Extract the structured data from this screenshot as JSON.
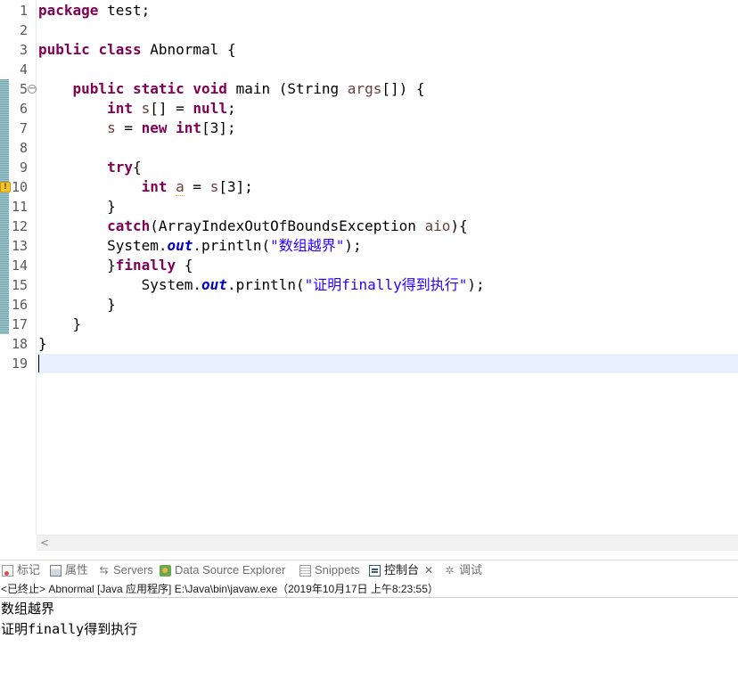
{
  "editor": {
    "current_line": 19,
    "lines": [
      {
        "num": "1",
        "tokens": [
          {
            "t": "package",
            "c": "kw"
          },
          {
            "t": " test;",
            "c": ""
          }
        ]
      },
      {
        "num": "2",
        "tokens": []
      },
      {
        "num": "3",
        "tokens": [
          {
            "t": "public",
            "c": "kw"
          },
          {
            "t": " ",
            "c": ""
          },
          {
            "t": "class",
            "c": "kw"
          },
          {
            "t": " Abnormal {",
            "c": ""
          }
        ]
      },
      {
        "num": "4",
        "tokens": []
      },
      {
        "num": "5",
        "tokens": [
          {
            "t": "    ",
            "c": ""
          },
          {
            "t": "public",
            "c": "kw"
          },
          {
            "t": " ",
            "c": ""
          },
          {
            "t": "static",
            "c": "kw"
          },
          {
            "t": " ",
            "c": ""
          },
          {
            "t": "void",
            "c": "kw"
          },
          {
            "t": " main (String ",
            "c": ""
          },
          {
            "t": "args",
            "c": "var"
          },
          {
            "t": "[]) {",
            "c": ""
          }
        ]
      },
      {
        "num": "6",
        "tokens": [
          {
            "t": "        ",
            "c": ""
          },
          {
            "t": "int",
            "c": "kw"
          },
          {
            "t": " ",
            "c": ""
          },
          {
            "t": "s",
            "c": "var"
          },
          {
            "t": "[] = ",
            "c": ""
          },
          {
            "t": "null",
            "c": "kw"
          },
          {
            "t": ";",
            "c": ""
          }
        ]
      },
      {
        "num": "7",
        "tokens": [
          {
            "t": "        ",
            "c": ""
          },
          {
            "t": "s",
            "c": "var"
          },
          {
            "t": " = ",
            "c": ""
          },
          {
            "t": "new",
            "c": "kw"
          },
          {
            "t": " ",
            "c": ""
          },
          {
            "t": "int",
            "c": "kw"
          },
          {
            "t": "[3];",
            "c": ""
          }
        ]
      },
      {
        "num": "8",
        "tokens": []
      },
      {
        "num": "9",
        "tokens": [
          {
            "t": "        ",
            "c": ""
          },
          {
            "t": "try",
            "c": "kw"
          },
          {
            "t": "{",
            "c": ""
          }
        ]
      },
      {
        "num": "10",
        "tokens": [
          {
            "t": "            ",
            "c": ""
          },
          {
            "t": "int",
            "c": "kw"
          },
          {
            "t": " ",
            "c": ""
          },
          {
            "t": "a",
            "c": "var-warn"
          },
          {
            "t": " = ",
            "c": ""
          },
          {
            "t": "s",
            "c": "var"
          },
          {
            "t": "[3];",
            "c": ""
          }
        ]
      },
      {
        "num": "11",
        "tokens": [
          {
            "t": "        }",
            "c": ""
          }
        ]
      },
      {
        "num": "12",
        "tokens": [
          {
            "t": "        ",
            "c": ""
          },
          {
            "t": "catch",
            "c": "kw"
          },
          {
            "t": "(ArrayIndexOutOfBoundsException ",
            "c": ""
          },
          {
            "t": "aio",
            "c": "var"
          },
          {
            "t": "){",
            "c": ""
          }
        ]
      },
      {
        "num": "13",
        "tokens": [
          {
            "t": "        System.",
            "c": ""
          },
          {
            "t": "out",
            "c": "fld"
          },
          {
            "t": ".println(",
            "c": ""
          },
          {
            "t": "\"数组越界\"",
            "c": "str"
          },
          {
            "t": ");",
            "c": ""
          }
        ]
      },
      {
        "num": "14",
        "tokens": [
          {
            "t": "        }",
            "c": ""
          },
          {
            "t": "finally",
            "c": "kw"
          },
          {
            "t": " {",
            "c": ""
          }
        ]
      },
      {
        "num": "15",
        "tokens": [
          {
            "t": "            System.",
            "c": ""
          },
          {
            "t": "out",
            "c": "fld"
          },
          {
            "t": ".println(",
            "c": ""
          },
          {
            "t": "\"证明finally得到执行\"",
            "c": "str"
          },
          {
            "t": ");",
            "c": ""
          }
        ]
      },
      {
        "num": "16",
        "tokens": [
          {
            "t": "        }",
            "c": ""
          }
        ]
      },
      {
        "num": "17",
        "tokens": [
          {
            "t": "    }",
            "c": ""
          }
        ]
      },
      {
        "num": "18",
        "tokens": [
          {
            "t": "}",
            "c": ""
          }
        ]
      },
      {
        "num": "19",
        "tokens": []
      }
    ],
    "fold_line": 5,
    "warning_line": 10,
    "fold_icon": "collapse-minus-icon",
    "warning_icon": "warning-lightbulb-icon",
    "changed_lines": {
      "from": 5,
      "to": 17
    },
    "scroll_left_glyph": "<"
  },
  "views": {
    "tabs": [
      {
        "label": "标记",
        "icon": "markers-icon",
        "active": false
      },
      {
        "label": "属性",
        "icon": "properties-icon",
        "active": false
      },
      {
        "label": "Servers",
        "icon": "servers-icon",
        "active": false
      },
      {
        "label": "Data Source Explorer",
        "icon": "data-source-explorer-icon",
        "active": false
      },
      {
        "label": "Snippets",
        "icon": "snippets-icon",
        "active": false
      },
      {
        "label": "控制台",
        "icon": "console-icon",
        "active": true
      },
      {
        "label": "调试",
        "icon": "debug-icon",
        "active": false
      }
    ],
    "close_glyph": "✕"
  },
  "console": {
    "header": "<已终止> Abnormal [Java 应用程序] E:\\Java\\bin\\javaw.exe（2019年10月17日 上午8:23:55）",
    "output": [
      "数组越界",
      "证明finally得到执行"
    ]
  },
  "colors": {
    "keyword": "#7f0055",
    "string": "#2a00ff",
    "static_field": "#0000c0",
    "local_variable": "#6a3e3e",
    "current_line_bg": "#e8f2fe",
    "change_bar": "#6fa8b0"
  }
}
